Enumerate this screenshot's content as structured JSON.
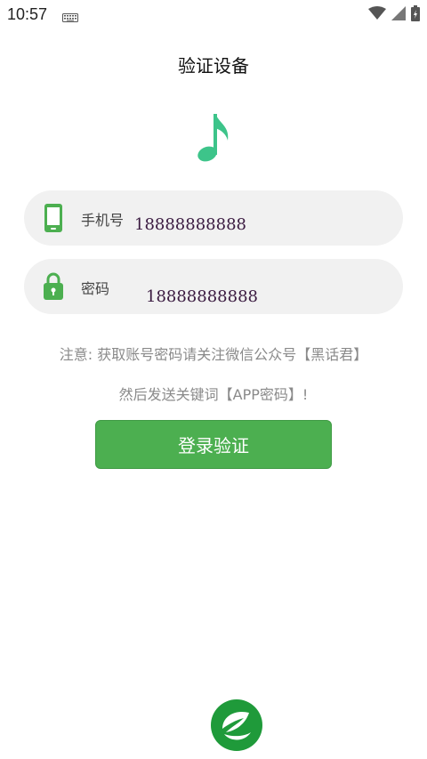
{
  "status_bar": {
    "time": "10:57"
  },
  "page": {
    "title": "验证设备"
  },
  "form": {
    "phone": {
      "label": "手机号",
      "value": "18888888888"
    },
    "password": {
      "label": "密码",
      "value": "18888888888"
    }
  },
  "notes": {
    "line1": "注意: 获取账号密码请关注微信公众号【黑话君】",
    "line2": "然后发送关键词【APP密码】!"
  },
  "actions": {
    "login_label": "登录验证"
  },
  "colors": {
    "accent": "#4caf50",
    "note_icon": "#3dc48a",
    "field_bg": "#f1f1f1"
  },
  "icons": {
    "phone": "phone-icon",
    "lock": "lock-icon",
    "note": "music-note-icon",
    "logo": "leaf-logo-icon"
  }
}
